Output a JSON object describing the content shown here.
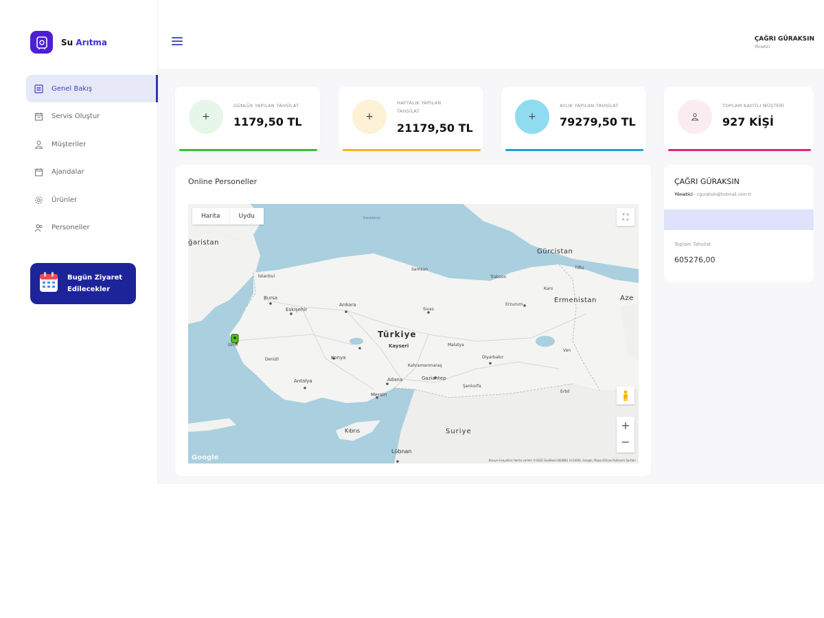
{
  "brand": {
    "name_part1": "Su",
    "name_part2": "Arıtma"
  },
  "sidebar": {
    "items": [
      {
        "label": "Genel Bakış",
        "icon": "dashboard-icon",
        "active": true
      },
      {
        "label": "Servis Oluştur",
        "icon": "calendar-plus-icon",
        "active": false
      },
      {
        "label": "Müşteriler",
        "icon": "user-icon",
        "active": false
      },
      {
        "label": "Ajandalar",
        "icon": "calendar-icon",
        "active": false
      },
      {
        "label": "Ürünler",
        "icon": "gear-icon",
        "active": false
      },
      {
        "label": "Personeller",
        "icon": "users-icon",
        "active": false
      }
    ],
    "visit_card": {
      "line1": "Bugün Ziyaret",
      "line2": "Edilecekler",
      "icon": "calendar-icon"
    }
  },
  "header": {
    "user_name": "ÇAĞRI GÜRAKSIN",
    "user_role": "Yönetici"
  },
  "stats": [
    {
      "label": "GÜNLÜK YAPILAN TAHSİLAT",
      "value": "1179,50 TL",
      "color": "#2fbf3c",
      "bg": "#e6f7ea",
      "icon": "plus-icon"
    },
    {
      "label": "HAFTALIK YAPILAN TAHSİLAT",
      "value": "21179,50 TL",
      "color": "#f5b41c",
      "bg": "#fdf1d6",
      "icon": "plus-icon"
    },
    {
      "label": "AYLIK YAPILAN TAHSİLAT",
      "value": "79279,50 TL",
      "color": "#1a9fd6",
      "bg": "#8fdcf0",
      "icon": "plus-icon"
    },
    {
      "label": "TOPLAM KAYITLI MÜŞTERİ",
      "value": "927 KİŞİ",
      "color": "#e3227b",
      "bg": "#fbecf1",
      "icon": "user-icon"
    }
  ],
  "map_section": {
    "title": "Online Personeller",
    "toggle": [
      "Harita",
      "Uydu"
    ],
    "labels": {
      "turkey": "Türkiye",
      "georgia": "Gürcistan",
      "armenia": "Ermenistan",
      "syria": "Suriye",
      "cyprus": "Kıbrıs",
      "lebanon": "Lübnan",
      "bulgaria": "ğaristan",
      "azer": "Aze",
      "ankara": "Ankara",
      "bursa": "Bursa",
      "kayseri": "Kayseri",
      "konya": "Konya",
      "antalya": "Antalya",
      "adana": "Adana",
      "gaziantep": "Gaziantep",
      "mersin": "Mersin",
      "eskisehir": "Eskişehir",
      "izmir": "İzmir",
      "istanbul": "İstanbul",
      "samsun": "Samsun",
      "sivas": "Sivas",
      "erzurum": "Erzurum",
      "trabzon": "Trabzon",
      "diyarbakir": "Diyarbakır",
      "van": "Van",
      "kars": "Kars",
      "tiflis": "Tiflis",
      "kahramanmaras": "Kahramanmaraş",
      "malatya": "Malatya",
      "denizli": "Denizli",
      "sanliurfa": "Şanlıurfa",
      "erbil": "Erbil",
      "black_sea": "Karadeniz"
    },
    "credits": "Klavye kısayolları   Harita verileri ©2022 GeoBasis-DE/BKG (©2009), Google, Mapa GISrael   Kullanım Şartları",
    "google": "Google"
  },
  "profile": {
    "name": "ÇAĞRI GÜRAKSIN",
    "role": "Yönetici",
    "email": "cguraksin@hotmail.com.tr",
    "total_label": "Toplam Tahsilat",
    "total_value": "605276,00"
  }
}
